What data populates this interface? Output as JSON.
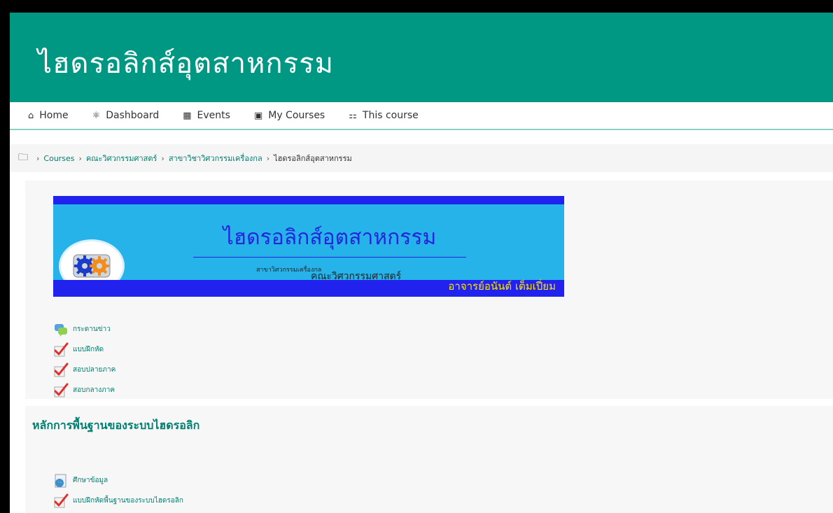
{
  "header": {
    "title": "ไฮดรอลิกส์อุตสาหกรรม"
  },
  "nav": {
    "items": [
      {
        "label": "Home",
        "icon": "home-icon"
      },
      {
        "label": "Dashboard",
        "icon": "dashboard-icon"
      },
      {
        "label": "Events",
        "icon": "calendar-icon"
      },
      {
        "label": "My Courses",
        "icon": "briefcase-icon"
      },
      {
        "label": "This course",
        "icon": "sitemap-icon"
      }
    ]
  },
  "breadcrumb": {
    "items": [
      "Courses",
      "คณะวิศวกรรมศาสตร์",
      "สาขาวิชาวิศวกรรมเครื่องกล"
    ],
    "current": "ไฮดรอลิกส์อุตสาหกรรม"
  },
  "banner": {
    "title": "ไฮดรอลิกส์อุตสาหกรรม",
    "subtitle1": "สาขาวิศวกรรมเครื่องกล",
    "subtitle2": "คณะวิศวกรรมศาสตร์",
    "author": "อาจารย์อนันต์ เต็มเปี่ยม"
  },
  "section1": {
    "activities": [
      {
        "label": "กระดานข่าว",
        "icon": "forum-icon"
      },
      {
        "label": "แบบฝึกหัด",
        "icon": "quiz-icon"
      },
      {
        "label": "สอบปลายภาค",
        "icon": "quiz-icon"
      },
      {
        "label": "สอบกลางภาค",
        "icon": "quiz-icon"
      }
    ]
  },
  "section2": {
    "title": "หลักการพื้นฐานของระบบไฮดรอลิก",
    "activities": [
      {
        "label": "ศึกษาข้อมูล",
        "icon": "url-icon"
      },
      {
        "label": "แบบฝึกหัดพื้นฐานของระบบไฮดรอลิก",
        "icon": "quiz-icon"
      }
    ]
  },
  "colors": {
    "header_bg": "#009882",
    "link": "#00806f",
    "banner_bg": "#26b3e9",
    "banner_stripe": "#2222ee",
    "banner_author": "#ffe600"
  }
}
